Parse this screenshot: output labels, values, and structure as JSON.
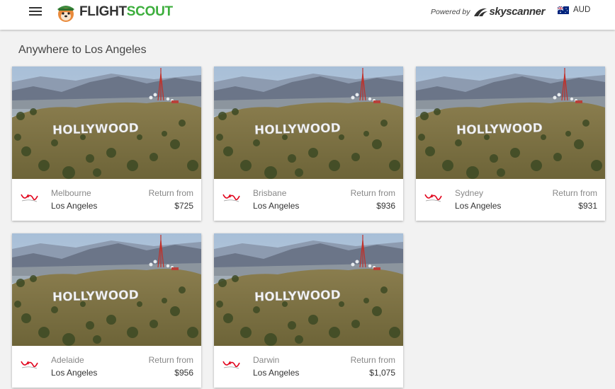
{
  "header": {
    "logo_text_1": "FLIGHT",
    "logo_text_2": "SCOUT",
    "powered_by": "Powered by",
    "partner": "skyscanner",
    "currency": "AUD"
  },
  "page": {
    "heading": "Anywhere to Los Angeles"
  },
  "common": {
    "return_label": "Return from"
  },
  "colors": {
    "brand_green": "#3cae3c",
    "virgin_red": "#e1001a"
  },
  "icons": {
    "menu": "hamburger-menu-icon",
    "logo": "dog-mascot-icon",
    "partner": "skyscanner-logo-icon",
    "flag": "australia-flag-icon",
    "airline": "virgin-airline-logo"
  },
  "destination_image": "Hollywood sign hillside photo",
  "cards": [
    {
      "origin": "Melbourne",
      "destination": "Los Angeles",
      "price": "$725"
    },
    {
      "origin": "Brisbane",
      "destination": "Los Angeles",
      "price": "$936"
    },
    {
      "origin": "Sydney",
      "destination": "Los Angeles",
      "price": "$931"
    },
    {
      "origin": "Adelaide",
      "destination": "Los Angeles",
      "price": "$956"
    },
    {
      "origin": "Darwin",
      "destination": "Los Angeles",
      "price": "$1,075"
    }
  ]
}
